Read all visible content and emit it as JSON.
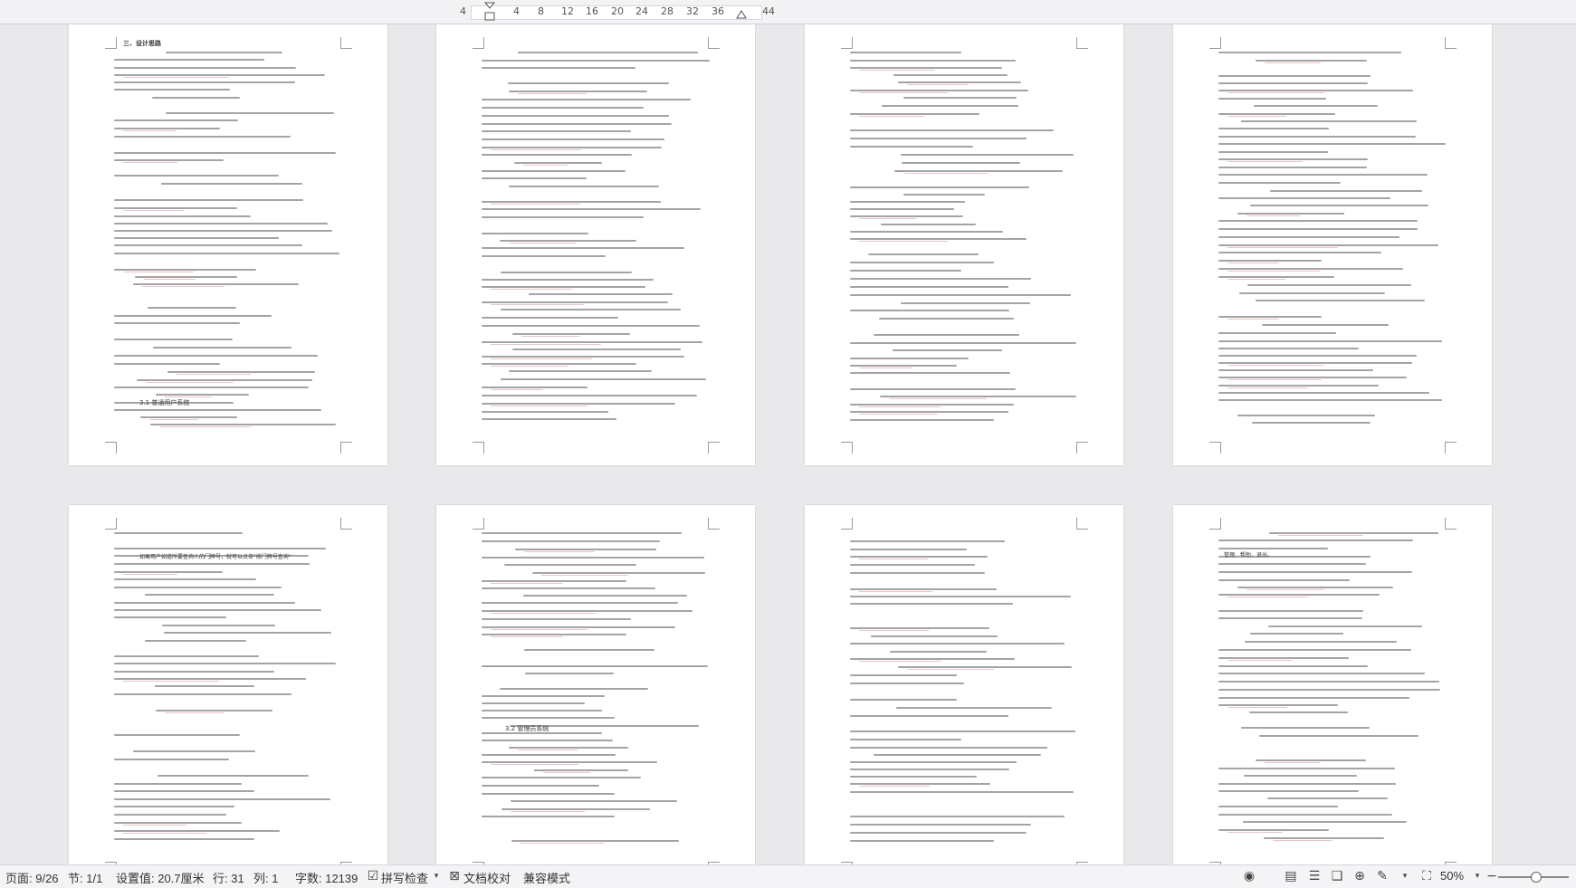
{
  "ruler": {
    "ticks": [
      "4",
      "4",
      "8",
      "12",
      "16",
      "20",
      "24",
      "28",
      "32",
      "36",
      "44"
    ]
  },
  "status_bar": {
    "page": "页面: 9/26",
    "section": "节: 1/1",
    "position": "设置值: 20.7厘米",
    "row": "行: 31",
    "column": "列: 1",
    "word_count": "字数: 12139",
    "spell_check": "拼写检查",
    "doc_proof": "文档校对",
    "compat_mode": "兼容模式",
    "zoom": "50%"
  },
  "page_snippets": {
    "p1_heading": "三、设计思路",
    "p1_section": "3.1  普通用户系统",
    "p5_intro": "如果用户如道所要查询人的门牌号，就可以点击\"按门牌号查询\"",
    "p6_section": "3.2  管理员系统",
    "p8_intro": "管理、帮助、退出。"
  }
}
